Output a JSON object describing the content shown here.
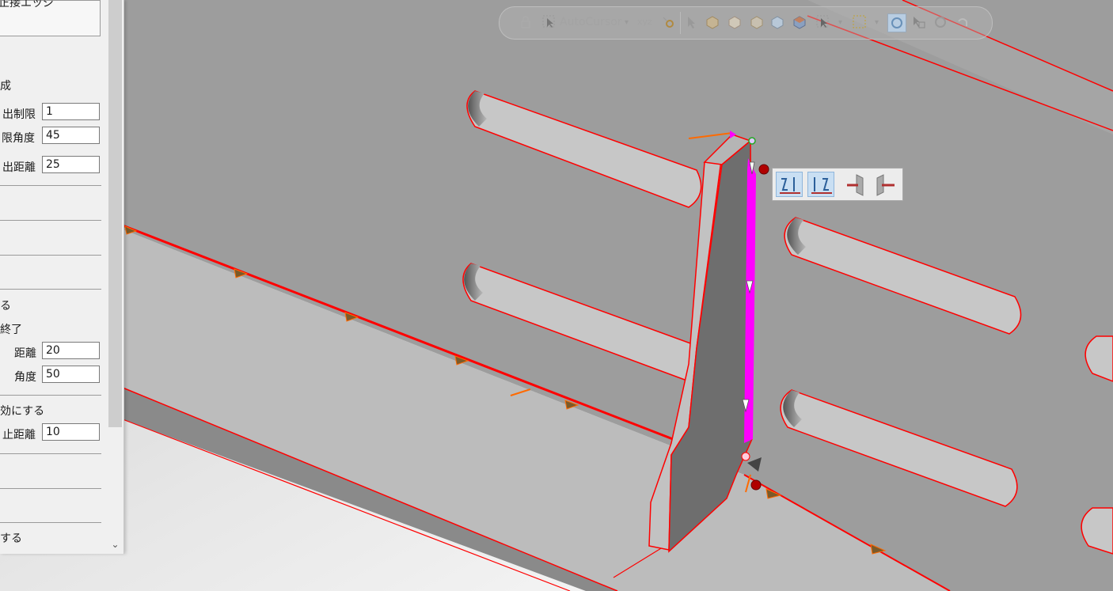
{
  "panel": {
    "top_partial_label": "正接エッジ",
    "section_1_label": "成",
    "rows_a": [
      {
        "label": "出制限",
        "value": "1"
      },
      {
        "label": "限角度",
        "value": "45"
      },
      {
        "label": "出距離",
        "value": "25"
      }
    ],
    "section_2_label": "る",
    "section_3_label": "終了",
    "rows_b": [
      {
        "label": "距離",
        "value": "20"
      },
      {
        "label": "角度",
        "value": "50"
      }
    ],
    "section_4_label": "効にする",
    "rows_c": [
      {
        "label": "止距離",
        "value": "10"
      }
    ],
    "bottom_label": "する"
  },
  "toolbar": {
    "autocursor_label": "AutoCursor",
    "xyz_label": "xyz"
  },
  "colors": {
    "viewport_bg": "#9a9a9a",
    "edge_red": "#ff0000",
    "selection_magenta": "#ff00ff",
    "arrow_orange": "#ff6a00"
  }
}
